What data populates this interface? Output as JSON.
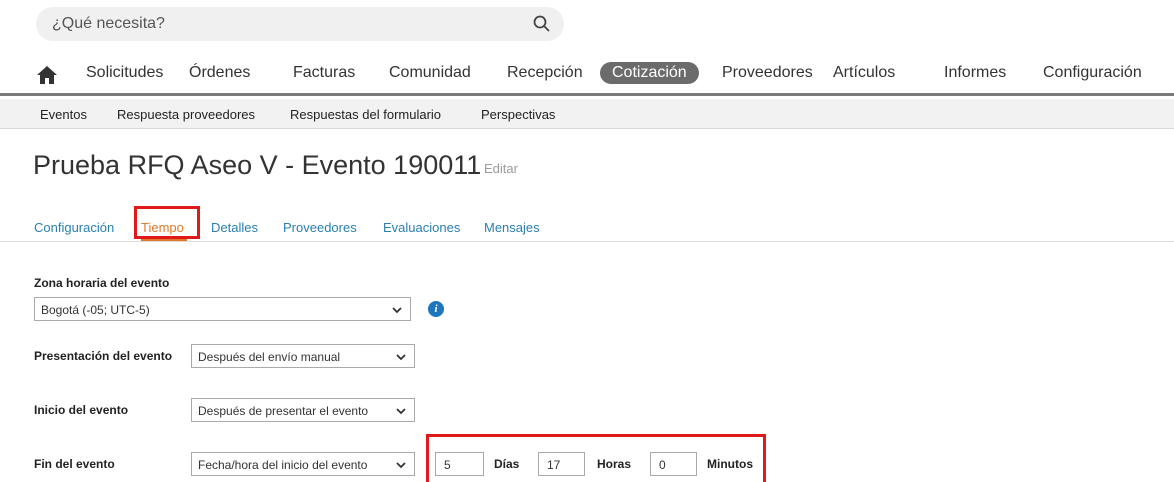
{
  "search": {
    "placeholder": "¿Qué necesita?",
    "icon": "search-icon"
  },
  "main_nav": {
    "items": [
      "Solicitudes",
      "Órdenes",
      "Facturas",
      "Comunidad",
      "Recepción",
      "Cotización",
      "Proveedores",
      "Artículos",
      "Informes",
      "Configuración"
    ],
    "active": "Cotización"
  },
  "sub_nav": {
    "items": [
      "Eventos",
      "Respuesta proveedores",
      "Respuestas del formulario",
      "Perspectivas"
    ]
  },
  "page": {
    "title": "Prueba RFQ Aseo V - Evento 190011",
    "edit": "Editar"
  },
  "tabs": {
    "items": [
      "Configuración",
      "Tiempo",
      "Detalles",
      "Proveedores",
      "Evaluaciones",
      "Mensajes"
    ],
    "active": "Tiempo"
  },
  "form": {
    "timezone": {
      "label": "Zona horaria del evento",
      "value": "Bogotá (-05; UTC-5)"
    },
    "presentation": {
      "label": "Presentación del evento",
      "value": "Después del envío manual"
    },
    "start": {
      "label": "Inicio del evento",
      "value": "Después de presentar el evento"
    },
    "end": {
      "label": "Fin del evento",
      "value": "Fecha/hora del inicio del evento",
      "days": "5",
      "days_label": "Días",
      "hours": "17",
      "hours_label": "Horas",
      "minutes": "0",
      "minutes_label": "Minutos"
    }
  },
  "colors": {
    "accent_tab": "#e07a2a",
    "link": "#2a7fb0",
    "highlight": "#e01a1a",
    "active_pill": "#6b6b6b",
    "info": "#1f76bd"
  }
}
